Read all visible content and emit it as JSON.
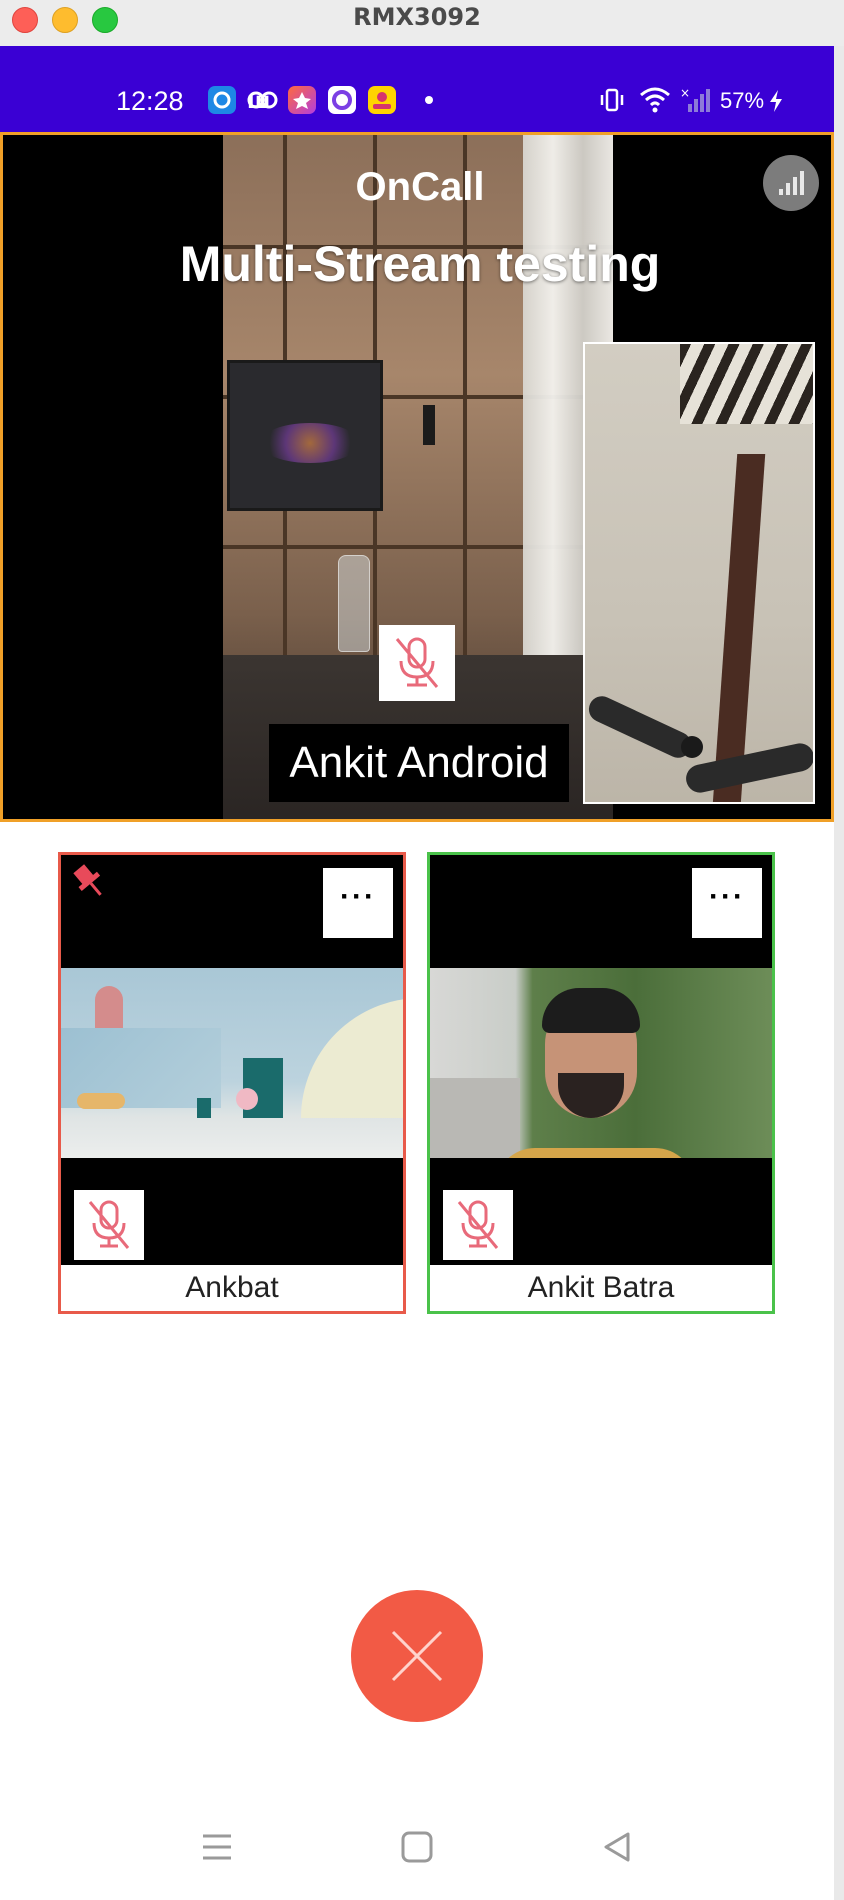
{
  "window": {
    "title": "RMX3092"
  },
  "status_bar": {
    "time": "12:28",
    "battery": "57%",
    "background_color": "#3a00d4",
    "app_icons": [
      "app-icon-blue-circle",
      "app-icon-wb",
      "app-icon-pink",
      "app-icon-purple-ring",
      "app-icon-yellow"
    ],
    "system_icons": [
      "vibrate-icon",
      "wifi-icon",
      "cellular-signal-icon",
      "battery-charging-icon"
    ]
  },
  "stage": {
    "app_name": "OnCall",
    "conference_name": "Multi-Stream testing",
    "participant_name": "Ankit Android",
    "border_color": "#f0a028"
  },
  "tiles": [
    {
      "name": "Ankbat",
      "border_color": "#e85a4a",
      "pinned": true,
      "more_label": "···"
    },
    {
      "name": "Ankit Batra",
      "border_color": "#4ac24a",
      "pinned": false,
      "more_label": "···"
    }
  ],
  "end_call": {
    "color": "#f25a45"
  },
  "nav_bar": {
    "icons": [
      "menu-icon",
      "home-icon",
      "back-icon"
    ]
  }
}
